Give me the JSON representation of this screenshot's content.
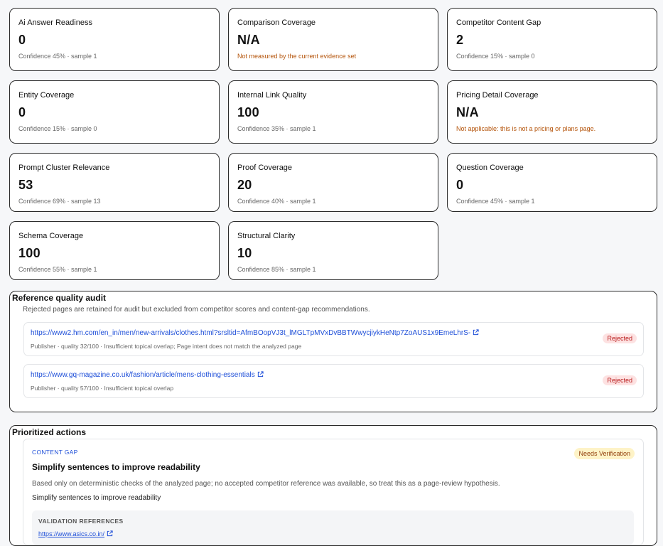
{
  "metrics": [
    {
      "label": "Ai Answer Readiness",
      "value": "0",
      "sub": "Confidence 45% · sample 1"
    },
    {
      "label": "Comparison Coverage",
      "value": "N/A",
      "note": "Not measured by the current evidence set"
    },
    {
      "label": "Competitor Content Gap",
      "value": "2",
      "sub": "Confidence 15% · sample 0"
    },
    {
      "label": "Entity Coverage",
      "value": "0",
      "sub": "Confidence 15% · sample 0"
    },
    {
      "label": "Internal Link Quality",
      "value": "100",
      "sub": "Confidence 35% · sample 1"
    },
    {
      "label": "Pricing Detail Coverage",
      "value": "N/A",
      "note": "Not applicable: this is not a pricing or plans page."
    },
    {
      "label": "Prompt Cluster Relevance",
      "value": "53",
      "sub": "Confidence 69% · sample 13"
    },
    {
      "label": "Proof Coverage",
      "value": "20",
      "sub": "Confidence 40% · sample 1"
    },
    {
      "label": "Question Coverage",
      "value": "0",
      "sub": "Confidence 45% · sample 1"
    },
    {
      "label": "Schema Coverage",
      "value": "100",
      "sub": "Confidence 55% · sample 1"
    },
    {
      "label": "Structural Clarity",
      "value": "10",
      "sub": "Confidence 85% · sample 1"
    }
  ],
  "audit": {
    "title": "Reference quality audit",
    "description": "Rejected pages are retained for audit but excluded from competitor scores and content-gap recommendations.",
    "rows": [
      {
        "url": "https://www2.hm.com/en_in/men/new-arrivals/clothes.html?srsltid=AfmBOopVJ3t_lMGLTpMVxDvBBTWwycjiykHeNtp7ZoAUS1x9EmeLhrS-",
        "meta": "Publisher · quality 32/100 · Insufficient topical overlap; Page intent does not match the analyzed page",
        "status": "Rejected"
      },
      {
        "url": "https://www.gq-magazine.co.uk/fashion/article/mens-clothing-essentials",
        "meta": "Publisher · quality 57/100 · Insufficient topical overlap",
        "status": "Rejected"
      }
    ]
  },
  "actions": {
    "title": "Prioritized actions",
    "item": {
      "kicker": "CONTENT GAP",
      "badge": "Needs Verification",
      "title": "Simplify sentences to improve readability",
      "description": "Based only on deterministic checks of the analyzed page; no accepted competitor reference was available, so treat this as a page-review hypothesis.",
      "recommendation": "Simplify sentences to improve readability",
      "validation_title": "VALIDATION REFERENCES",
      "validation_link": "https://www.asics.co.in/"
    }
  },
  "colors": {
    "accent": "#1d4ed8",
    "warning": "#b45309",
    "rejected_bg": "#fde2e2",
    "rejected_fg": "#b91c1c",
    "verify_bg": "#fef3c7"
  },
  "icons": {
    "external": "external-link-icon"
  }
}
